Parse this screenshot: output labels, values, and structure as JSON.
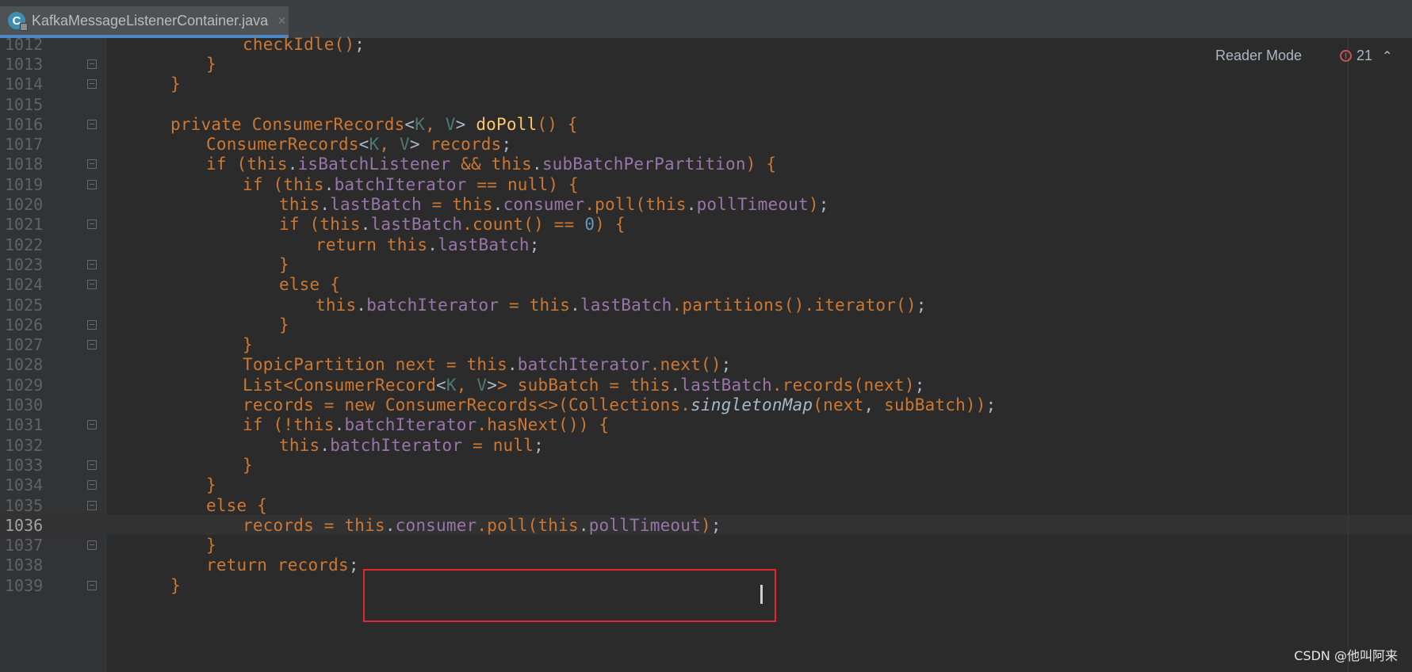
{
  "tab": {
    "icon": "C",
    "filename": "KafkaMessageListenerContainer.java",
    "close": "×"
  },
  "toolbar": {
    "reader_mode": "Reader Mode",
    "problem_count": "21",
    "error_icon": "!"
  },
  "watermark": "CSDN @他叫阿来",
  "lines": [
    {
      "n": "1012",
      "fold": false,
      "code": "checkIdle();"
    },
    {
      "n": "1013",
      "fold": true,
      "code": "}"
    },
    {
      "n": "1014",
      "fold": true,
      "code": "}"
    },
    {
      "n": "1015",
      "fold": false,
      "code": ""
    },
    {
      "n": "1016",
      "fold": true,
      "code": "private ConsumerRecords<K, V> doPoll() {"
    },
    {
      "n": "1017",
      "fold": false,
      "code": "ConsumerRecords<K, V> records;"
    },
    {
      "n": "1018",
      "fold": true,
      "code": "if (this.isBatchListener && this.subBatchPerPartition) {"
    },
    {
      "n": "1019",
      "fold": true,
      "code": "if (this.batchIterator == null) {"
    },
    {
      "n": "1020",
      "fold": false,
      "code": "this.lastBatch = this.consumer.poll(this.pollTimeout);"
    },
    {
      "n": "1021",
      "fold": true,
      "code": "if (this.lastBatch.count() == 0) {"
    },
    {
      "n": "1022",
      "fold": false,
      "code": "return this.lastBatch;"
    },
    {
      "n": "1023",
      "fold": true,
      "code": "}"
    },
    {
      "n": "1024",
      "fold": true,
      "code": "else {"
    },
    {
      "n": "1025",
      "fold": false,
      "code": "this.batchIterator = this.lastBatch.partitions().iterator();"
    },
    {
      "n": "1026",
      "fold": true,
      "code": "}"
    },
    {
      "n": "1027",
      "fold": true,
      "code": "}"
    },
    {
      "n": "1028",
      "fold": false,
      "code": "TopicPartition next = this.batchIterator.next();"
    },
    {
      "n": "1029",
      "fold": false,
      "code": "List<ConsumerRecord<K, V>> subBatch = this.lastBatch.records(next);"
    },
    {
      "n": "1030",
      "fold": false,
      "code": "records = new ConsumerRecords<>(Collections.singletonMap(next, subBatch));"
    },
    {
      "n": "1031",
      "fold": true,
      "code": "if (!this.batchIterator.hasNext()) {"
    },
    {
      "n": "1032",
      "fold": false,
      "code": "this.batchIterator = null;"
    },
    {
      "n": "1033",
      "fold": true,
      "code": "}"
    },
    {
      "n": "1034",
      "fold": true,
      "code": "}"
    },
    {
      "n": "1035",
      "fold": true,
      "code": "else {"
    },
    {
      "n": "1036",
      "fold": false,
      "code": "records = this.consumer.poll(this.pollTimeout);"
    },
    {
      "n": "1037",
      "fold": true,
      "code": "}"
    },
    {
      "n": "1038",
      "fold": false,
      "code": "return records;"
    },
    {
      "n": "1039",
      "fold": true,
      "code": "}"
    }
  ],
  "current_line": "1036"
}
